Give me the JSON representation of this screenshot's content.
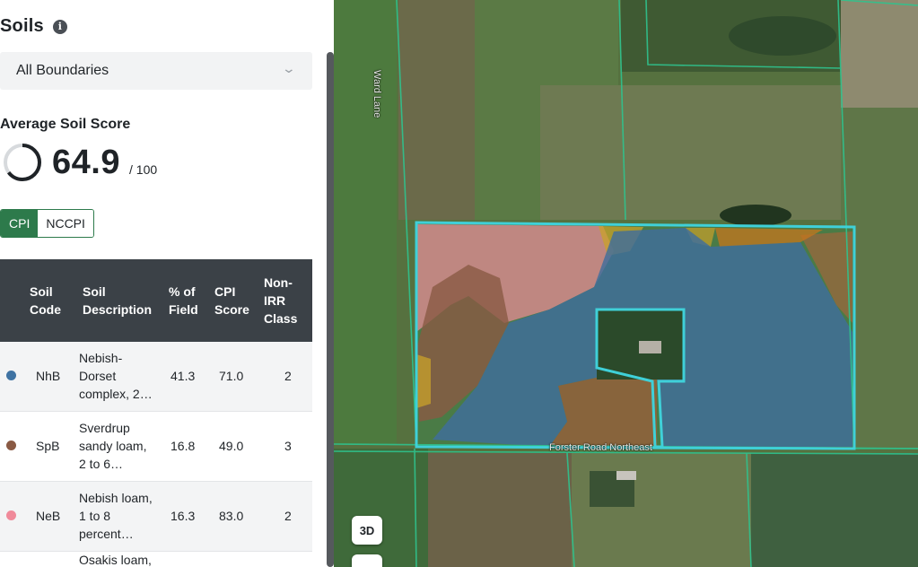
{
  "panel": {
    "title": "Soils",
    "info_icon": "info-icon",
    "boundary_select": {
      "selected": "All Boundaries"
    },
    "average": {
      "label": "Average Soil Score",
      "value": "64.9",
      "max": "/ 100",
      "gauge_fraction": 0.649
    },
    "toggle": {
      "options": [
        "CPI",
        "NCCPI"
      ],
      "active": "CPI"
    },
    "table": {
      "headers": {
        "code": [
          "Soil",
          "Code"
        ],
        "description": [
          "Soil",
          "Description"
        ],
        "percent": [
          "% of",
          "Field"
        ],
        "cpi": [
          "CPI",
          "Score"
        ],
        "class": [
          "Non-",
          "IRR",
          "Class"
        ]
      },
      "rows": [
        {
          "color": "#3f73a3",
          "code": "NhB",
          "description": [
            "Nebish-",
            "Dorset",
            "complex, 2…"
          ],
          "percent": "41.3",
          "cpi": "71.0",
          "class": "2"
        },
        {
          "color": "#8a5a44",
          "code": "SpB",
          "description": [
            "Sverdrup",
            "sandy loam,",
            "2 to 6…"
          ],
          "percent": "16.8",
          "cpi": "49.0",
          "class": "3"
        },
        {
          "color": "#f08a9a",
          "code": "NeB",
          "description": [
            "Nebish loam,",
            "1 to 8",
            "percent…"
          ],
          "percent": "16.3",
          "cpi": "83.0",
          "class": "2"
        }
      ],
      "partial_row_text": "Osakis loam,"
    }
  },
  "map": {
    "road_labels": {
      "west": "Ward Lane",
      "south": "Forster Road Northeast"
    },
    "buttons": {
      "three_d": "3D",
      "layers_icon": "layers-icon"
    },
    "colors": {
      "boundary": "#3fd0d8",
      "parcel_lines": "#2fc38e"
    }
  }
}
